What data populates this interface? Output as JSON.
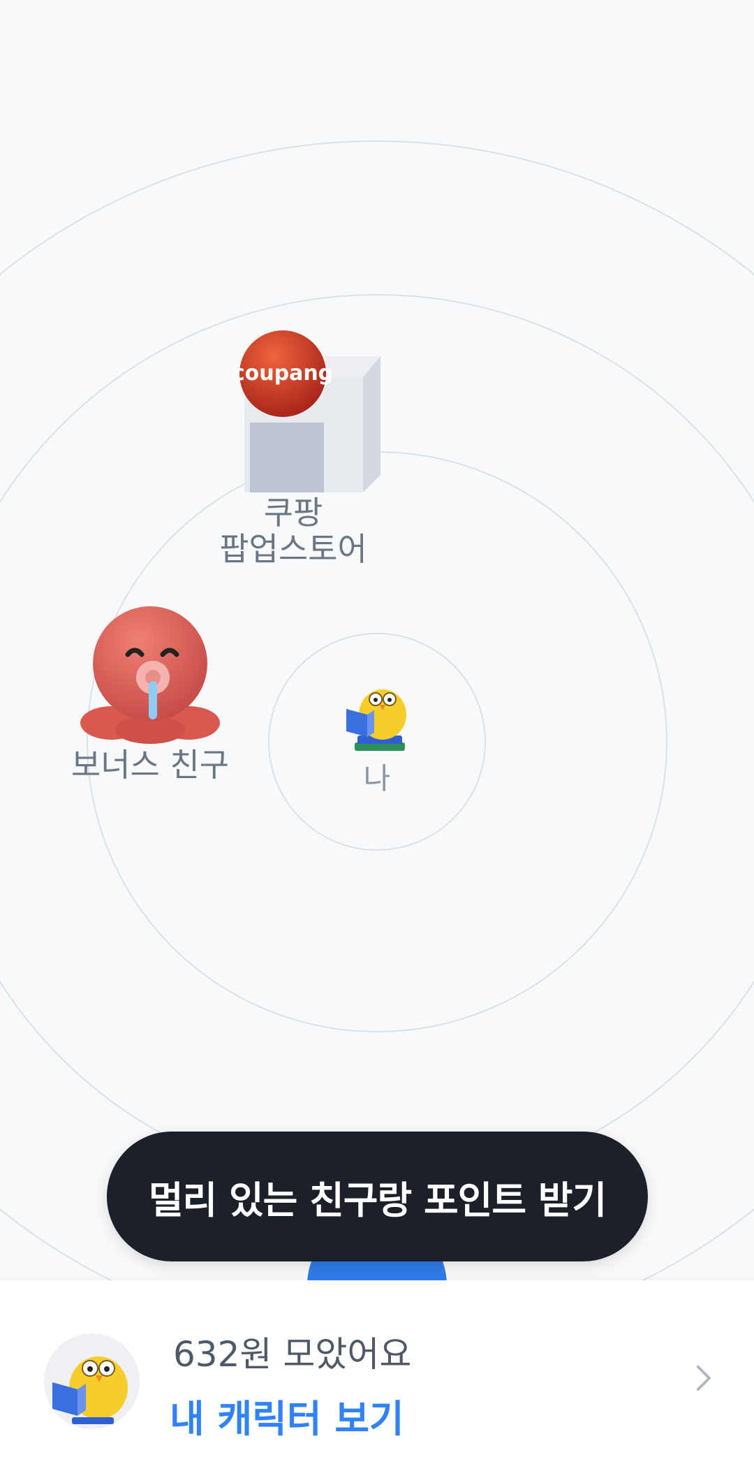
{
  "radar": {
    "coupang": {
      "logo_text": "coupang",
      "label": "쿠팡\n팝업스토어"
    },
    "bonus": {
      "label": "보너스 친구"
    },
    "me": {
      "label": "나"
    }
  },
  "cta": {
    "label": "멀리 있는 친구랑 포인트 받기"
  },
  "bottom": {
    "points_text": "632원 모았어요",
    "link_label": "내 캐릭터 보기"
  },
  "icons": {
    "coupang": "coupang-store-icon",
    "bonus": "octopus-character-icon",
    "me": "reading-chick-character-icon",
    "earth": "earth-globe-icon",
    "avatar": "reading-chick-avatar",
    "chevron": "chevron-right-icon"
  },
  "colors": {
    "background": "#f8f9fb",
    "cta_background": "#1b2029",
    "link_blue": "#3182f6",
    "coupang_red": "#c9381f",
    "octopus": "#e0625a"
  }
}
